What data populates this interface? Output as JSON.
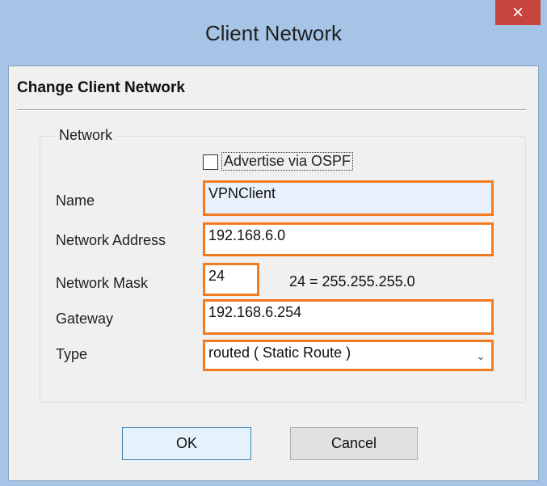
{
  "window": {
    "title": "Client Network",
    "close_glyph": "×"
  },
  "heading": "Change Client Network",
  "group": {
    "legend": "Network",
    "advertise_ospf": {
      "label": "Advertise via OSPF",
      "checked": false
    },
    "name": {
      "label": "Name",
      "value": "VPNClient"
    },
    "network_address": {
      "label": "Network Address",
      "value": "192.168.6.0"
    },
    "network_mask": {
      "label": "Network Mask",
      "value": "24",
      "hint": "24 = 255.255.255.0"
    },
    "gateway": {
      "label": "Gateway",
      "value": "192.168.6.254"
    },
    "type": {
      "label": "Type",
      "value": "routed  ( Static Route )"
    }
  },
  "buttons": {
    "ok": "OK",
    "cancel": "Cancel"
  },
  "colors": {
    "highlight": "#f47a20",
    "titlebar": "#a6c4e6",
    "close": "#c7443f"
  }
}
